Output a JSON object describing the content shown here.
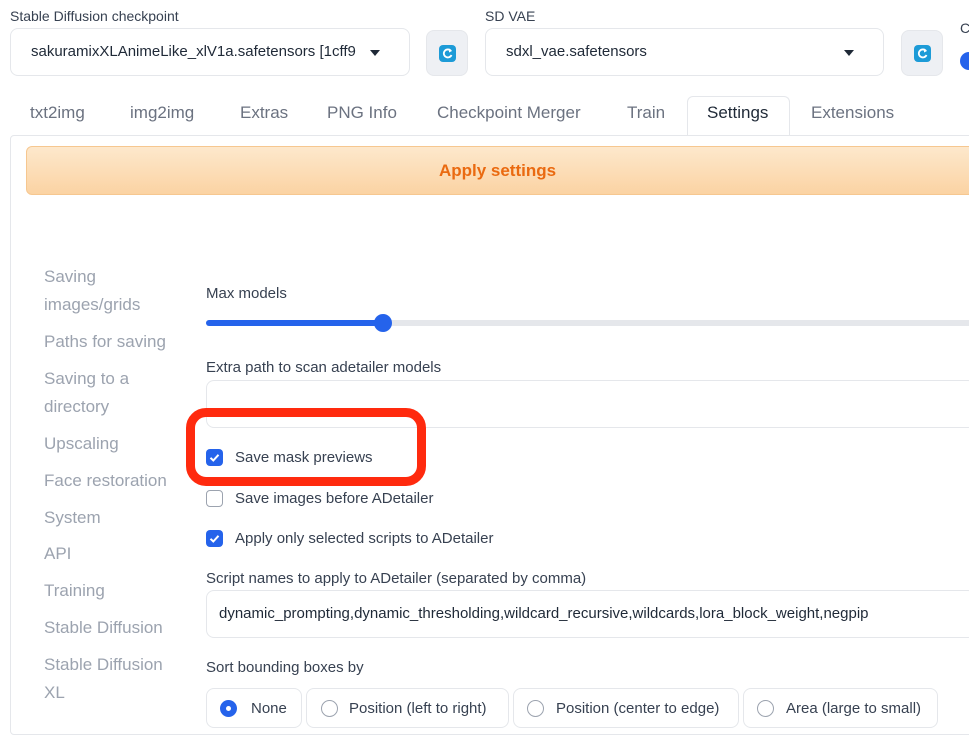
{
  "header": {
    "checkpoint": {
      "label": "Stable Diffusion checkpoint",
      "value": "sakuramixXLAnimeLike_xlV1a.safetensors [1cff9"
    },
    "vae": {
      "label": "SD VAE",
      "value": "sdxl_vae.safetensors"
    },
    "clip_label": "C"
  },
  "tabs": [
    "txt2img",
    "img2img",
    "Extras",
    "PNG Info",
    "Checkpoint Merger",
    "Train",
    "Settings",
    "Extensions"
  ],
  "active_tab": "Settings",
  "apply_button": "Apply settings",
  "sidebar": [
    [
      "Saving",
      "images/grids"
    ],
    [
      "Paths for saving"
    ],
    [
      "Saving to a",
      "directory"
    ],
    [
      "Upscaling"
    ],
    [
      "Face restoration"
    ],
    [
      "System"
    ],
    [
      "API"
    ],
    [
      "Training"
    ],
    [
      "Stable Diffusion"
    ],
    [
      "Stable Diffusion",
      "XL"
    ]
  ],
  "settings": {
    "max_models": {
      "label": "Max models",
      "value_fraction": 0.23
    },
    "extra_path": {
      "label": "Extra path to scan adetailer models",
      "value": ""
    },
    "save_mask_previews": {
      "label": "Save mask previews",
      "checked": true
    },
    "save_images_before": {
      "label": "Save images before ADetailer",
      "checked": false
    },
    "apply_only_selected": {
      "label": "Apply only selected scripts to ADetailer",
      "checked": true
    },
    "script_names": {
      "label": "Script names to apply to ADetailer (separated by comma)",
      "value": "dynamic_prompting,dynamic_thresholding,wildcard_recursive,wildcards,lora_block_weight,negpip"
    },
    "sort_bbox": {
      "label": "Sort bounding boxes by",
      "options": [
        "None",
        "Position (left to right)",
        "Position (center to edge)",
        "Area (large to small)"
      ],
      "selected": "None"
    }
  },
  "colors": {
    "accent": "#2563eb",
    "apply_text": "#ea6a10",
    "highlight": "#ff2a0e"
  }
}
